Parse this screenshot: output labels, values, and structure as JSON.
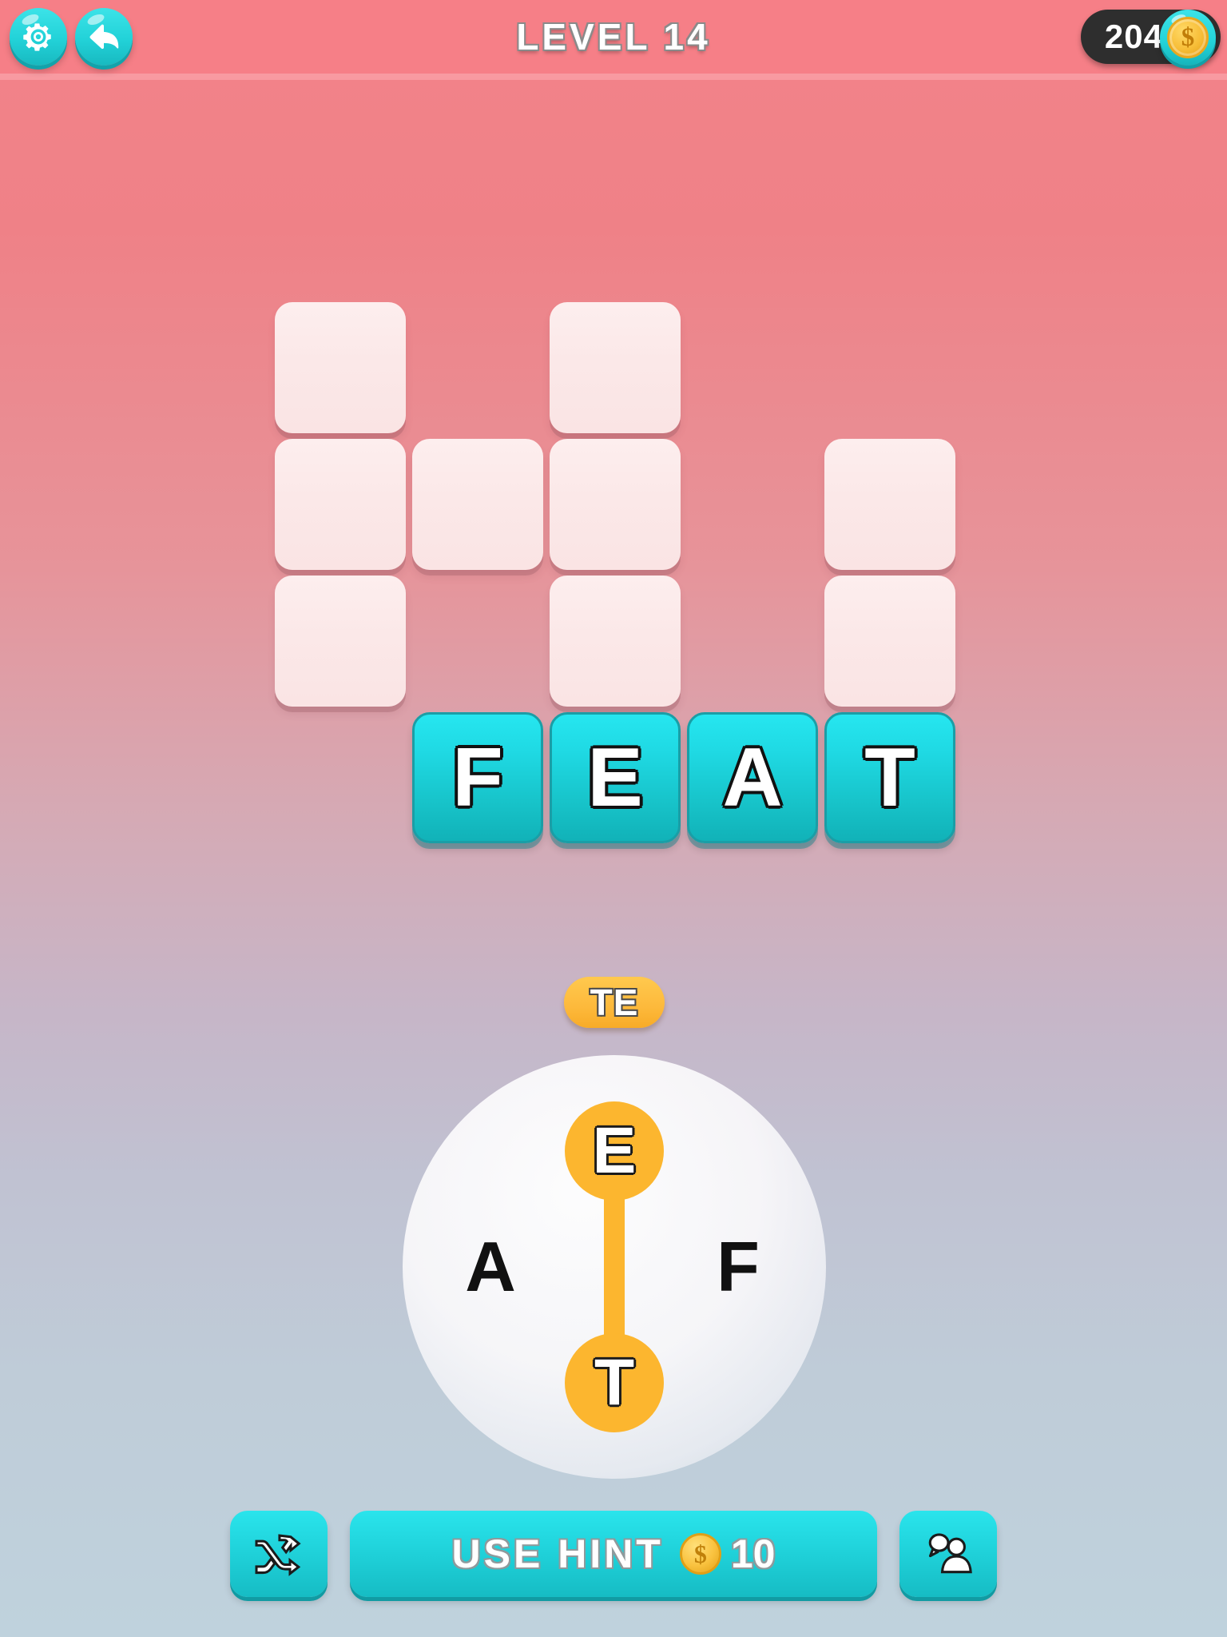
{
  "header": {
    "level_title": "LEVEL 14",
    "settings_icon": "gear-icon",
    "back_icon": "back-arrow-icon",
    "coin_count": "204",
    "coin_symbol": "$",
    "accent_cyan": "#22d2d8",
    "header_pink": "#f67f87",
    "pill_dark": "#2e2e2e"
  },
  "board": {
    "empty_tile_color": "#fbe8e8",
    "solved_tile_color": "#1fd9e3",
    "rows": [
      {
        "cells": [
          {
            "state": "empty",
            "letter": "",
            "col": 0
          },
          {
            "state": "blank",
            "letter": "",
            "col": 1
          },
          {
            "state": "empty",
            "letter": "",
            "col": 2
          },
          {
            "state": "blank",
            "letter": "",
            "col": 3
          }
        ]
      },
      {
        "cells": [
          {
            "state": "empty",
            "letter": "",
            "col": 0
          },
          {
            "state": "empty",
            "letter": "",
            "col": 1
          },
          {
            "state": "empty",
            "letter": "",
            "col": 2
          },
          {
            "state": "blank",
            "letter": "",
            "col": 3
          },
          {
            "state": "empty",
            "letter": "",
            "col": 4
          }
        ]
      },
      {
        "cells": [
          {
            "state": "empty",
            "letter": "",
            "col": 0
          },
          {
            "state": "blank",
            "letter": "",
            "col": 1
          },
          {
            "state": "empty",
            "letter": "",
            "col": 2
          },
          {
            "state": "blank",
            "letter": "",
            "col": 3
          },
          {
            "state": "empty",
            "letter": "",
            "col": 4
          }
        ]
      },
      {
        "cells": [
          {
            "state": "solved",
            "letter": "F",
            "col": 1
          },
          {
            "state": "solved",
            "letter": "E",
            "col": 2
          },
          {
            "state": "solved",
            "letter": "A",
            "col": 3
          },
          {
            "state": "solved",
            "letter": "T",
            "col": 4
          }
        ]
      }
    ],
    "solved_word": "FEAT"
  },
  "current_guess": {
    "text": "TE",
    "badge_color": "#fdb93b"
  },
  "wheel": {
    "letters": [
      {
        "char": "E",
        "position": "top",
        "selected": true
      },
      {
        "char": "T",
        "position": "bottom",
        "selected": true
      },
      {
        "char": "A",
        "position": "left",
        "selected": false
      },
      {
        "char": "F",
        "position": "right",
        "selected": false
      }
    ],
    "selection_color": "#fcb62f",
    "dial_color": "#ffffff"
  },
  "bottom_bar": {
    "shuffle_icon": "shuffle-icon",
    "use_hint_label": "USE HINT",
    "hint_cost": "10",
    "coin_symbol": "$",
    "friend_hint_icon": "person-speech-bubble-icon"
  }
}
